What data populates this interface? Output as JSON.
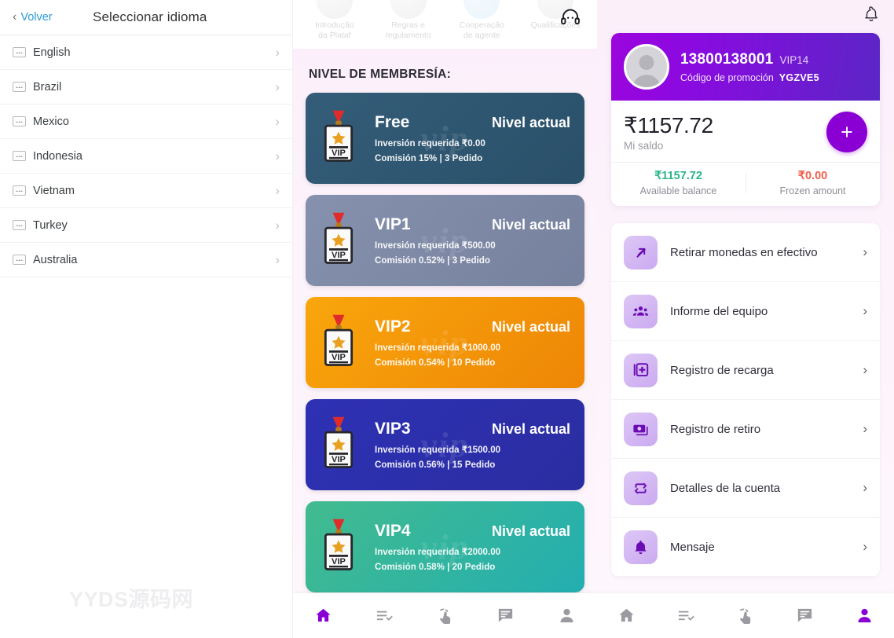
{
  "language_panel": {
    "back_label": "Volver",
    "title": "Seleccionar idioma",
    "back_icon": "chevron-left-icon",
    "items": [
      {
        "label": "English",
        "icon": "flag-placeholder-icon",
        "chevron": "›"
      },
      {
        "label": "Brazil",
        "icon": "flag-placeholder-icon",
        "chevron": "›"
      },
      {
        "label": "Mexico",
        "icon": "flag-placeholder-icon",
        "chevron": "›"
      },
      {
        "label": "Indonesia",
        "icon": "flag-placeholder-icon",
        "chevron": "›"
      },
      {
        "label": "Vietnam",
        "icon": "flag-placeholder-icon",
        "chevron": "›"
      },
      {
        "label": "Turkey",
        "icon": "flag-placeholder-icon",
        "chevron": "›"
      },
      {
        "label": "Australia",
        "icon": "flag-placeholder-icon",
        "chevron": "›"
      }
    ],
    "watermark": "YYDS源码网"
  },
  "vip_panel": {
    "top_categories": [
      {
        "line1": "Introdução",
        "line2": "da Plataf"
      },
      {
        "line1": "Regras e",
        "line2": "regulamento"
      },
      {
        "line1": "Cooperação",
        "line2": "de agente"
      },
      {
        "line1": "Qualificações",
        "line2": ""
      }
    ],
    "support_icon": "headset-icon",
    "section_title": "NIVEL DE MEMBRESÍA:",
    "card_watermark": "vip",
    "levels": [
      {
        "name": "Free",
        "status": "Nivel actual",
        "investment": "Inversión requerida ₹0.00",
        "commission": "Comisión 15% | 3 Pedido",
        "color_from": "#2f5773",
        "color_to": "#2c5470",
        "badge_icon": "vip-medal-icon"
      },
      {
        "name": "VIP1",
        "status": "Nivel actual",
        "investment": "Inversión requerida ₹500.00",
        "commission": "Comisión 0.52% | 3 Pedido",
        "color_from": "#7f8aa8",
        "color_to": "#7b86a3",
        "badge_icon": "vip-medal-icon"
      },
      {
        "name": "VIP2",
        "status": "Nivel actual",
        "investment": "Inversión requerida ₹1000.00",
        "commission": "Comisión 0.54% | 10 Pedido",
        "color_from": "#f59b0b",
        "color_to": "#ef8a09",
        "badge_icon": "vip-medal-icon"
      },
      {
        "name": "VIP3",
        "status": "Nivel actual",
        "investment": "Inversión requerida ₹1500.00",
        "commission": "Comisión 0.56% | 15 Pedido",
        "color_from": "#2b2ea8",
        "color_to": "#2a2da6",
        "badge_icon": "vip-medal-icon"
      },
      {
        "name": "VIP4",
        "status": "Nivel actual",
        "investment": "Inversión requerida ₹2000.00",
        "commission": "Comisión 0.58% | 20 Pedido",
        "color_from": "#3bb593",
        "color_to": "#2eb0a4",
        "badge_icon": "vip-medal-icon"
      }
    ]
  },
  "profile_panel": {
    "bell_icon": "bell-icon",
    "user": {
      "phone": "13800138001",
      "vip_tag": "VIP14",
      "promo_label": "Código de promoción",
      "promo_code": "YGZVE5",
      "avatar_icon": "avatar-icon"
    },
    "balance": {
      "amount": "₹1157.72",
      "label": "Mi saldo",
      "add_label": "+",
      "available_value": "₹1157.72",
      "available_label": "Available balance",
      "available_color": "#2bb58a",
      "frozen_value": "₹0.00",
      "frozen_label": "Frozen amount",
      "frozen_color": "#f0604d"
    },
    "menu": [
      {
        "label": "Retirar monedas en efectivo",
        "icon": "arrow-up-right-icon",
        "chevron": "›"
      },
      {
        "label": "Informe del equipo",
        "icon": "team-group-icon",
        "chevron": "›"
      },
      {
        "label": "Registro de recarga",
        "icon": "add-card-icon",
        "chevron": "›"
      },
      {
        "label": "Registro de retiro",
        "icon": "banknote-icon",
        "chevron": "›"
      },
      {
        "label": "Detalles de la cuenta",
        "icon": "repeat-arrows-icon",
        "chevron": "›"
      },
      {
        "label": "Mensaje",
        "icon": "bell-filled-icon",
        "chevron": "›"
      }
    ]
  },
  "bottom_nav": {
    "items": [
      {
        "icon": "home-icon"
      },
      {
        "icon": "tasks-checklist-icon"
      },
      {
        "icon": "tap-hand-icon"
      },
      {
        "icon": "chat-bubble-icon"
      },
      {
        "icon": "person-icon"
      }
    ],
    "vip_panel_active_index": 0,
    "profile_panel_active_index": 4,
    "active_color": "#8a00d4",
    "inactive_color": "#9a9aa0"
  }
}
